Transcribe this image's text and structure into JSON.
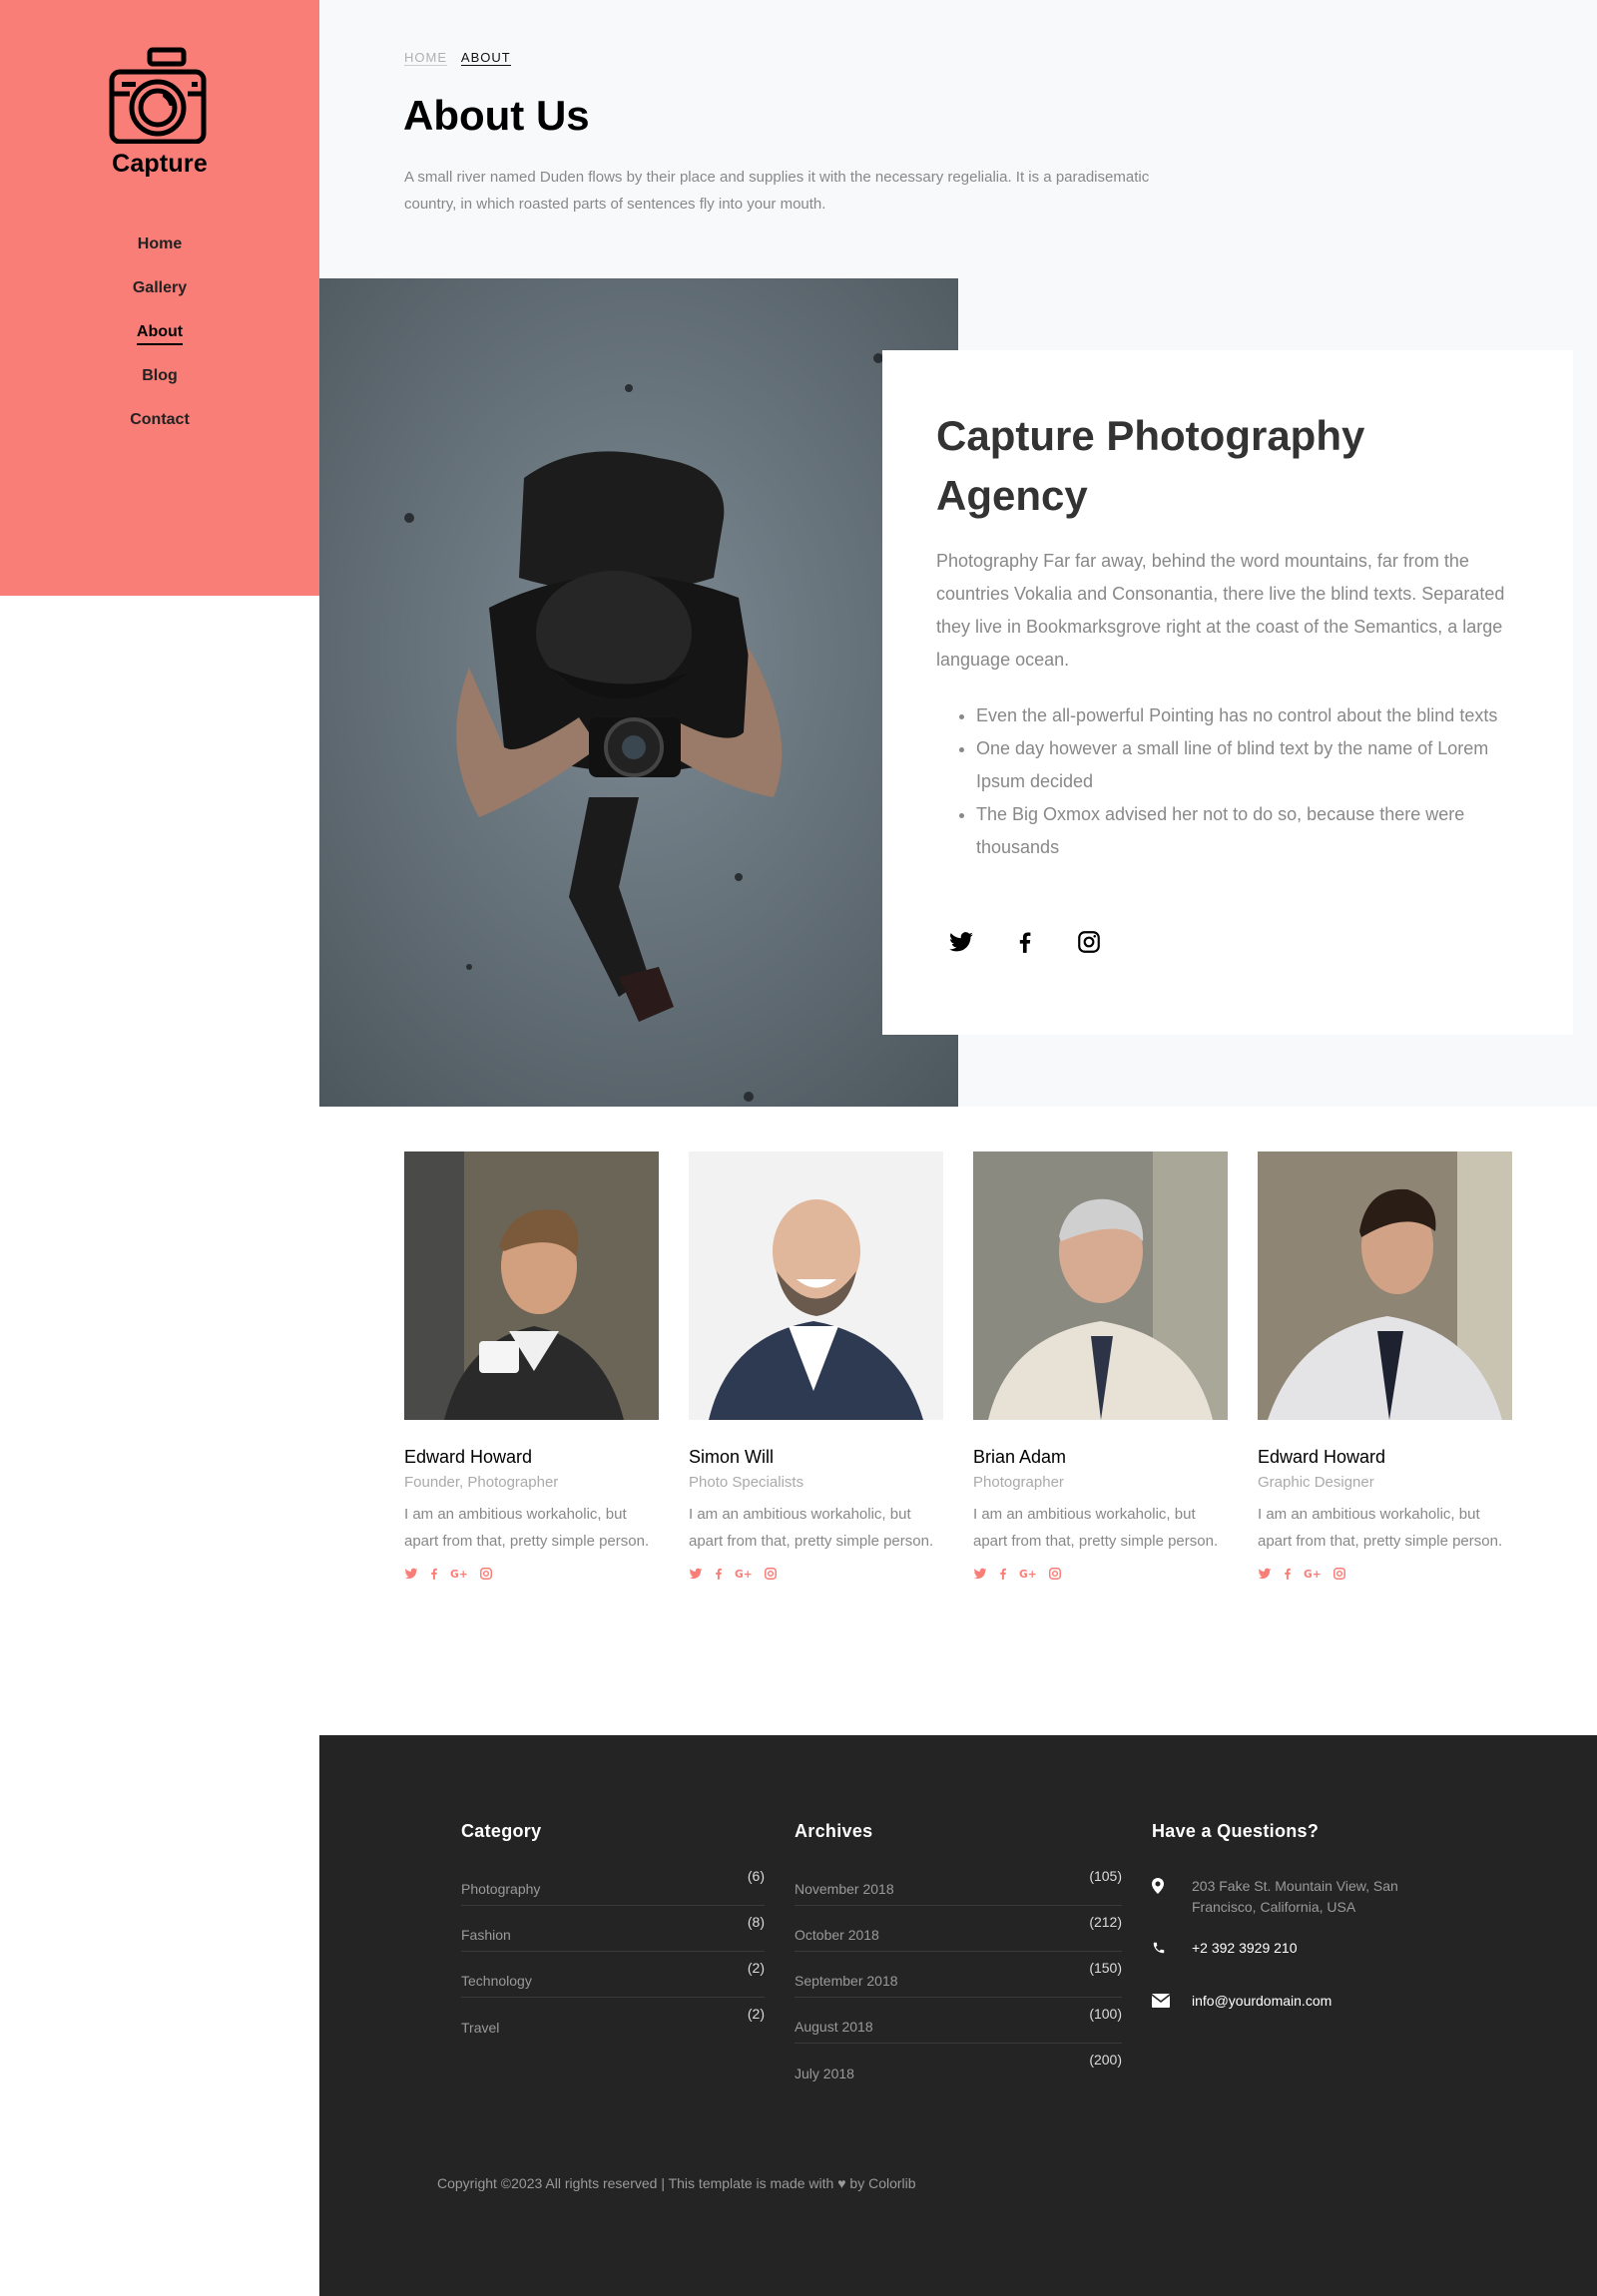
{
  "brand": {
    "name": "Capture",
    "icon": "camera-icon",
    "accent": "#f97e78"
  },
  "nav": [
    {
      "label": "Home",
      "active": false
    },
    {
      "label": "Gallery",
      "active": false
    },
    {
      "label": "About",
      "active": true
    },
    {
      "label": "Blog",
      "active": false
    },
    {
      "label": "Contact",
      "active": false
    }
  ],
  "breadcrumb": {
    "home": "HOME",
    "current": "ABOUT"
  },
  "page": {
    "title": "About Us",
    "intro": "A small river named Duden flows by their place and supplies it with the necessary regelialia. It is a paradisematic country, in which roasted parts of sentences fly into your mouth."
  },
  "agency": {
    "title": "Capture Photography Agency",
    "text": "Photography Far far away, behind the word mountains, far from the countries Vokalia and Consonantia, there live the blind texts. Separated they live in Bookmarksgrove right at the coast of the Semantics, a large language ocean.",
    "bullets": [
      "Even the all-powerful Pointing has no control about the blind texts",
      "One day however a small line of blind text by the name of Lorem Ipsum decided",
      "The Big Oxmox advised her not to do so, because there were thousands"
    ],
    "socials": [
      "twitter-icon",
      "facebook-icon",
      "instagram-icon"
    ]
  },
  "team": [
    {
      "name": "Edward Howard",
      "role": "Founder, Photographer",
      "bio": "I am an ambitious workaholic, but apart from that, pretty simple person."
    },
    {
      "name": "Simon Will",
      "role": "Photo Specialists",
      "bio": "I am an ambitious workaholic, but apart from that, pretty simple person."
    },
    {
      "name": "Brian Adam",
      "role": "Photographer",
      "bio": "I am an ambitious workaholic, but apart from that, pretty simple person."
    },
    {
      "name": "Edward Howard",
      "role": "Graphic Designer",
      "bio": "I am an ambitious workaholic, but apart from that, pretty simple person."
    }
  ],
  "footer": {
    "category": {
      "heading": "Category",
      "items": [
        {
          "label": "Photography",
          "count": "(6)"
        },
        {
          "label": "Fashion",
          "count": "(8)"
        },
        {
          "label": "Technology",
          "count": "(2)"
        },
        {
          "label": "Travel",
          "count": "(2)"
        }
      ]
    },
    "archives": {
      "heading": "Archives",
      "items": [
        {
          "label": "November 2018",
          "count": "(105)"
        },
        {
          "label": "October 2018",
          "count": "(212)"
        },
        {
          "label": "September 2018",
          "count": "(150)"
        },
        {
          "label": "August 2018",
          "count": "(100)"
        },
        {
          "label": "July 2018",
          "count": "(200)"
        }
      ]
    },
    "contact": {
      "heading": "Have a Questions?",
      "address": "203 Fake St. Mountain View, San Francisco, California, USA",
      "phone": "+2 392 3929 210",
      "email": "info@yourdomain.com"
    },
    "copyright_prefix": "Copyright ©2023 All rights reserved | This template is made with",
    "copyright_suffix": "by Colorlib"
  }
}
